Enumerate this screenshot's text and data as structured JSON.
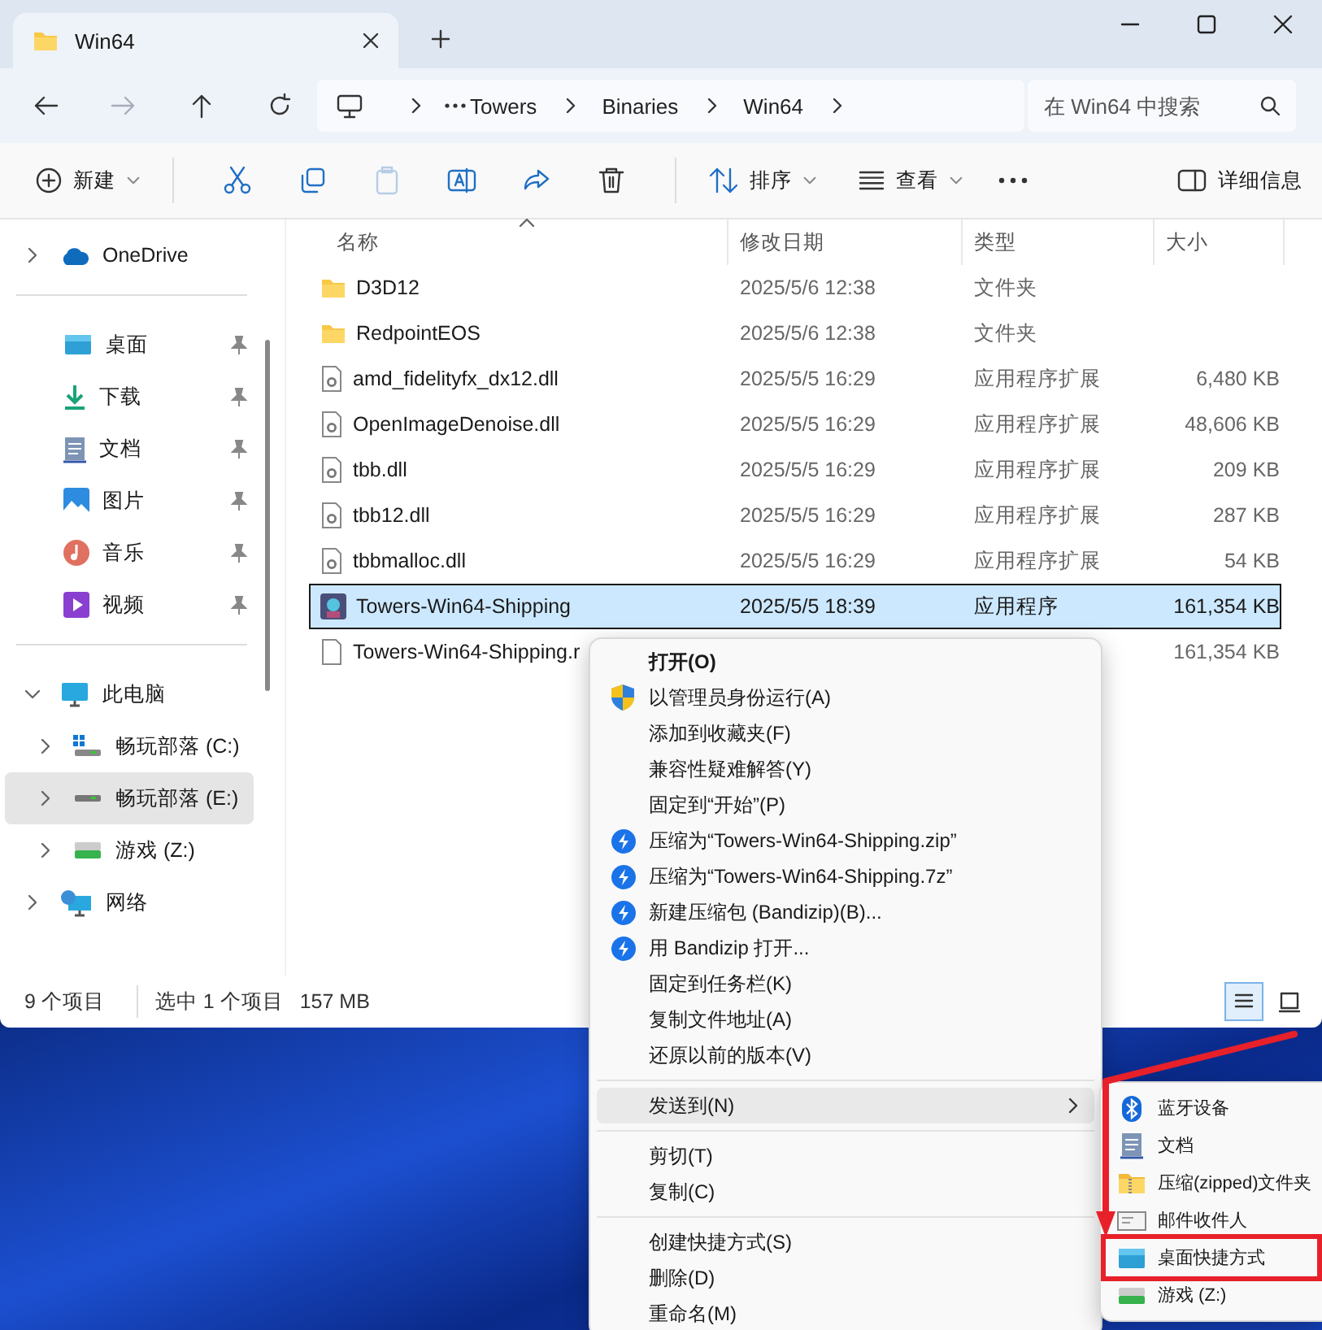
{
  "window": {
    "tab_title": "Win64"
  },
  "nav": [
    {
      "kind": "back",
      "disabled": false
    },
    {
      "kind": "forward",
      "disabled": true
    },
    {
      "kind": "up",
      "disabled": false
    },
    {
      "kind": "refresh",
      "disabled": false
    }
  ],
  "address": {
    "crumbs": [
      "Towers",
      "Binaries",
      "Win64"
    ],
    "search_placeholder": "在 Win64 中搜索"
  },
  "toolbar": {
    "new_label": "新建",
    "tools": [
      {
        "kind": "cut",
        "disabled": false
      },
      {
        "kind": "copy",
        "disabled": false
      },
      {
        "kind": "paste",
        "disabled": true
      },
      {
        "kind": "rename",
        "disabled": false
      },
      {
        "kind": "share",
        "disabled": false
      },
      {
        "kind": "delete",
        "disabled": false
      }
    ],
    "sort_label": "排序",
    "view_label": "查看",
    "details_label": "详细信息"
  },
  "sidebar": {
    "sections": [
      [
        {
          "label": "OneDrive",
          "kind": "cloud",
          "expanded": false,
          "selected": false
        }
      ],
      [
        {
          "label": "桌面",
          "kind": "desktop",
          "pinned": true,
          "selected": false
        },
        {
          "label": "下载",
          "kind": "download",
          "pinned": true,
          "selected": false
        },
        {
          "label": "文档",
          "kind": "document",
          "pinned": true,
          "selected": false
        },
        {
          "label": "图片",
          "kind": "pictures",
          "pinned": true,
          "selected": false
        },
        {
          "label": "音乐",
          "kind": "music",
          "pinned": true,
          "selected": false
        },
        {
          "label": "视频",
          "kind": "video",
          "pinned": true,
          "selected": false
        }
      ],
      [
        {
          "label": "此电脑",
          "kind": "computer",
          "expanded": true,
          "selected": false,
          "children": [
            {
              "label": "畅玩部落 (C:)",
              "kind": "system-drive",
              "expanded": false,
              "selected": false
            },
            {
              "label": "畅玩部落 (E:)",
              "kind": "drive",
              "expanded": false,
              "selected": true
            },
            {
              "label": "游戏 (Z:)",
              "kind": "green-drive",
              "expanded": false,
              "selected": false
            }
          ]
        },
        {
          "label": "网络",
          "kind": "network",
          "expanded": false,
          "selected": false
        }
      ]
    ]
  },
  "table": {
    "columns": [
      {
        "label": "名称",
        "sorted": true
      },
      {
        "label": "修改日期",
        "sorted": false
      },
      {
        "label": "类型",
        "sorted": false
      },
      {
        "label": "大小",
        "sorted": false
      }
    ],
    "rows": [
      {
        "name": "D3D12",
        "date": "2025/5/6 12:38",
        "type": "文件夹",
        "kind": "folder",
        "selected": false
      },
      {
        "name": "RedpointEOS",
        "date": "2025/5/6 12:38",
        "type": "文件夹",
        "kind": "folder",
        "selected": false
      },
      {
        "name": "amd_fidelityfx_dx12.dll",
        "date": "2025/5/5 16:29",
        "type": "应用程序扩展",
        "size": "6,480 KB",
        "kind": "dll",
        "selected": false
      },
      {
        "name": "OpenImageDenoise.dll",
        "date": "2025/5/5 16:29",
        "type": "应用程序扩展",
        "size": "48,606 KB",
        "kind": "dll",
        "selected": false
      },
      {
        "name": "tbb.dll",
        "date": "2025/5/5 16:29",
        "type": "应用程序扩展",
        "size": "209 KB",
        "kind": "dll",
        "selected": false
      },
      {
        "name": "tbb12.dll",
        "date": "2025/5/5 16:29",
        "type": "应用程序扩展",
        "size": "287 KB",
        "kind": "dll",
        "selected": false
      },
      {
        "name": "tbbmalloc.dll",
        "date": "2025/5/5 16:29",
        "type": "应用程序扩展",
        "size": "54 KB",
        "kind": "dll",
        "selected": false
      },
      {
        "name": "Towers-Win64-Shipping",
        "date": "2025/5/5 18:39",
        "type": "应用程序",
        "size": "161,354 KB",
        "kind": "app",
        "selected": true
      },
      {
        "name": "Towers-Win64-Shipping.r",
        "size": "161,354 KB",
        "kind": "file",
        "selected": false
      }
    ]
  },
  "status_bar": {
    "count": "9 个项目",
    "selection": "选中 1 个项目",
    "selection_size": "157 MB",
    "views": [
      {
        "kind": "details",
        "selected": true
      },
      {
        "kind": "tiles",
        "selected": false
      }
    ]
  },
  "context_menu": {
    "groups": [
      [
        {
          "label": "打开(O)",
          "kind": "plain",
          "default": true,
          "selected": false,
          "submenu": false
        },
        {
          "label": "以管理员身份运行(A)",
          "kind": "shield",
          "default": false,
          "selected": false,
          "submenu": false
        },
        {
          "label": "添加到收藏夹(F)",
          "kind": "plain",
          "default": false,
          "selected": false,
          "submenu": false
        },
        {
          "label": "兼容性疑难解答(Y)",
          "kind": "plain",
          "default": false,
          "selected": false,
          "submenu": false
        },
        {
          "label": "固定到“开始”(P)",
          "kind": "plain",
          "default": false,
          "selected": false,
          "submenu": false
        },
        {
          "label": "压缩为“Towers-Win64-Shipping.zip”",
          "kind": "bandizip",
          "default": false,
          "selected": false,
          "submenu": false
        },
        {
          "label": "压缩为“Towers-Win64-Shipping.7z”",
          "kind": "bandizip",
          "default": false,
          "selected": false,
          "submenu": false
        },
        {
          "label": "新建压缩包 (Bandizip)(B)...",
          "kind": "bandizip",
          "default": false,
          "selected": false,
          "submenu": false
        },
        {
          "label": "用 Bandizip 打开...",
          "kind": "bandizip",
          "default": false,
          "selected": false,
          "submenu": false
        },
        {
          "label": "固定到任务栏(K)",
          "kind": "plain",
          "default": false,
          "selected": false,
          "submenu": false
        },
        {
          "label": "复制文件地址(A)",
          "kind": "plain",
          "default": false,
          "selected": false,
          "submenu": false
        },
        {
          "label": "还原以前的版本(V)",
          "kind": "plain",
          "default": false,
          "selected": false,
          "submenu": false
        }
      ],
      [
        {
          "label": "发送到(N)",
          "kind": "plain",
          "default": false,
          "selected": true,
          "submenu": true
        }
      ],
      [
        {
          "label": "剪切(T)",
          "kind": "plain",
          "default": false,
          "selected": false,
          "submenu": false
        },
        {
          "label": "复制(C)",
          "kind": "plain",
          "default": false,
          "selected": false,
          "submenu": false
        }
      ],
      [
        {
          "label": "创建快捷方式(S)",
          "kind": "plain",
          "default": false,
          "selected": false,
          "submenu": false
        },
        {
          "label": "删除(D)",
          "kind": "plain",
          "default": false,
          "selected": false,
          "submenu": false
        },
        {
          "label": "重命名(M)",
          "kind": "plain",
          "default": false,
          "selected": false,
          "submenu": false
        }
      ]
    ]
  },
  "send_to_menu": {
    "items": [
      {
        "label": "蓝牙设备",
        "kind": "bluetooth",
        "marked": false
      },
      {
        "label": "文档",
        "kind": "document",
        "marked": false
      },
      {
        "label": "压缩(zipped)文件夹",
        "kind": "zip-folder",
        "marked": false
      },
      {
        "label": "邮件收件人",
        "kind": "mail",
        "marked": false
      },
      {
        "label": "桌面快捷方式",
        "kind": "desktop",
        "marked": true
      },
      {
        "label": "游戏 (Z:)",
        "kind": "green-drive",
        "marked": false
      }
    ]
  }
}
